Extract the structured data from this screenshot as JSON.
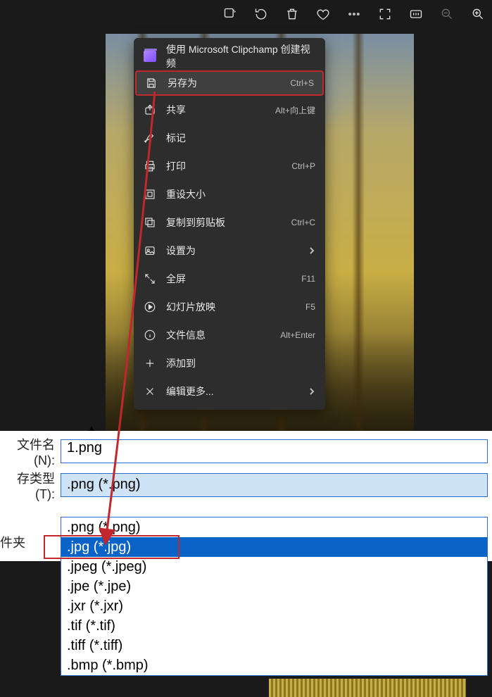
{
  "toolbar_icons": [
    "edit-sparkle",
    "rotate",
    "trash",
    "heart",
    "more",
    "fullscreen",
    "actual-size",
    "zoom-out",
    "zoom-in"
  ],
  "context_menu": {
    "clipchamp": "使用 Microsoft Clipchamp 创建视频",
    "items": [
      {
        "icon": "save",
        "label": "另存为",
        "shortcut": "Ctrl+S",
        "highlighted": true
      },
      {
        "icon": "share",
        "label": "共享",
        "shortcut": "Alt+向上键"
      },
      {
        "icon": "marker",
        "label": "标记",
        "shortcut": ""
      },
      {
        "icon": "print",
        "label": "打印",
        "shortcut": "Ctrl+P"
      },
      {
        "icon": "resize",
        "label": "重设大小",
        "shortcut": ""
      },
      {
        "icon": "copy",
        "label": "复制到剪贴板",
        "shortcut": "Ctrl+C"
      },
      {
        "icon": "setas",
        "label": "设置为",
        "shortcut": "",
        "submenu": true
      },
      {
        "icon": "expand",
        "label": "全屏",
        "shortcut": "F11"
      },
      {
        "icon": "slides",
        "label": "幻灯片放映",
        "shortcut": "F5"
      },
      {
        "icon": "info",
        "label": "文件信息",
        "shortcut": "Alt+Enter"
      },
      {
        "icon": "add",
        "label": "添加到",
        "shortcut": ""
      },
      {
        "icon": "editmore",
        "label": "编辑更多...",
        "shortcut": "",
        "submenu": true
      }
    ]
  },
  "save_dialog": {
    "filename_label": "文件名(N):",
    "filename_value": "1.png",
    "type_label": "存类型(T):",
    "type_value": ".png (*.png)",
    "folder_label": "件夹",
    "options": [
      ".png (*.png)",
      ".jpg (*.jpg)",
      ".jpeg (*.jpeg)",
      ".jpe (*.jpe)",
      ".jxr (*.jxr)",
      ".tif (*.tif)",
      ".tiff (*.tiff)",
      ".bmp (*.bmp)"
    ],
    "selected_index": 1
  },
  "annotation_color": "#c1272d"
}
